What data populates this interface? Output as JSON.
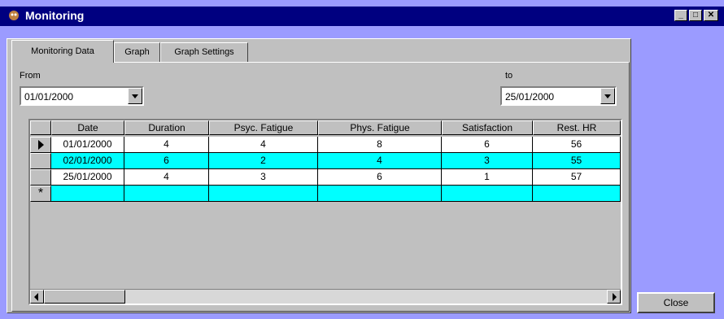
{
  "window": {
    "title": "Monitoring"
  },
  "tabs": [
    {
      "label": "Monitoring Data"
    },
    {
      "label": "Graph"
    },
    {
      "label": "Graph Settings"
    }
  ],
  "filters": {
    "from_label": "From",
    "from_value": "01/01/2000",
    "to_label": "to",
    "to_value": "25/01/2000"
  },
  "table": {
    "columns": [
      "Date",
      "Duration",
      "Psyc. Fatigue",
      "Phys. Fatigue",
      "Satisfaction",
      "Rest. HR"
    ],
    "rows": [
      [
        "01/01/2000",
        "4",
        "4",
        "8",
        "6",
        "56"
      ],
      [
        "02/01/2000",
        "6",
        "2",
        "4",
        "3",
        "55"
      ],
      [
        "25/01/2000",
        "4",
        "3",
        "6",
        "1",
        "57"
      ]
    ],
    "new_row_marker": "*"
  },
  "buttons": {
    "close": "Close"
  },
  "colors": {
    "highlight": "#00ffff",
    "titlebar": "#000080",
    "desktop": "#9b9bff"
  }
}
